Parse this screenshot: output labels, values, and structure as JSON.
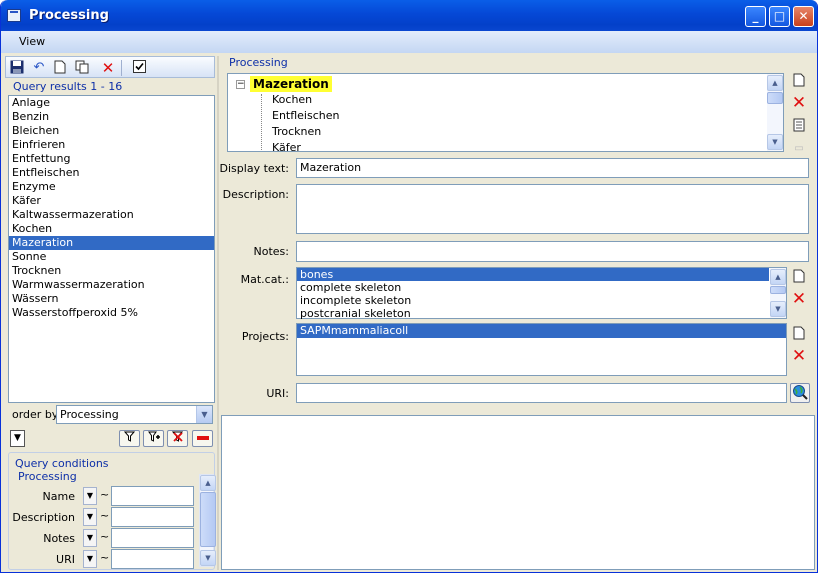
{
  "window": {
    "title": "Processing"
  },
  "menu": {
    "view": "View"
  },
  "toolbar": {
    "icons": [
      "save-icon",
      "undo-icon",
      "new-icon",
      "copy-icon",
      "delete-icon",
      "check-icon"
    ]
  },
  "query_results": {
    "caption": "Query results   1 - 16",
    "items": [
      "Anlage",
      "Benzin",
      "Bleichen",
      "Einfrieren",
      "Entfettung",
      "Entfleischen",
      "Enzyme",
      "Käfer",
      "Kaltwassermazeration",
      "Kochen",
      "Mazeration",
      "Sonne",
      "Trocknen",
      "Warmwassermazeration",
      "Wässern",
      "Wasserstoffperoxid 5%"
    ],
    "selected": "Mazeration"
  },
  "order_by": {
    "label": "order by:",
    "value": "Processing"
  },
  "query_conditions": {
    "caption": "Query conditions",
    "group": "Processing",
    "rows": [
      {
        "label": "Name",
        "tilde": "~"
      },
      {
        "label": "Description",
        "tilde": "~"
      },
      {
        "label": "Notes",
        "tilde": "~"
      },
      {
        "label": "URI",
        "tilde": "~"
      }
    ]
  },
  "processing": {
    "caption": "Processing",
    "tree_root": "Mazeration",
    "tree_children": [
      "Kochen",
      "Entfleischen",
      "Trocknen",
      "Käfer"
    ]
  },
  "form": {
    "display_text_label": "Display text:",
    "display_text_value": "Mazeration",
    "description_label": "Description:",
    "notes_label": "Notes:",
    "matcat_label": "Mat.cat.:",
    "matcat_items": [
      "bones",
      "complete skeleton",
      "incomplete skeleton",
      "postcranial skeleton"
    ],
    "matcat_selected": "bones",
    "projects_label": "Projects:",
    "projects_items": [
      "SAPMmammaliacoll"
    ],
    "uri_label": "URI:"
  },
  "colors": {
    "selection": "#316ac5",
    "highlight": "#ffff33",
    "titlebar": "#0548d6"
  }
}
